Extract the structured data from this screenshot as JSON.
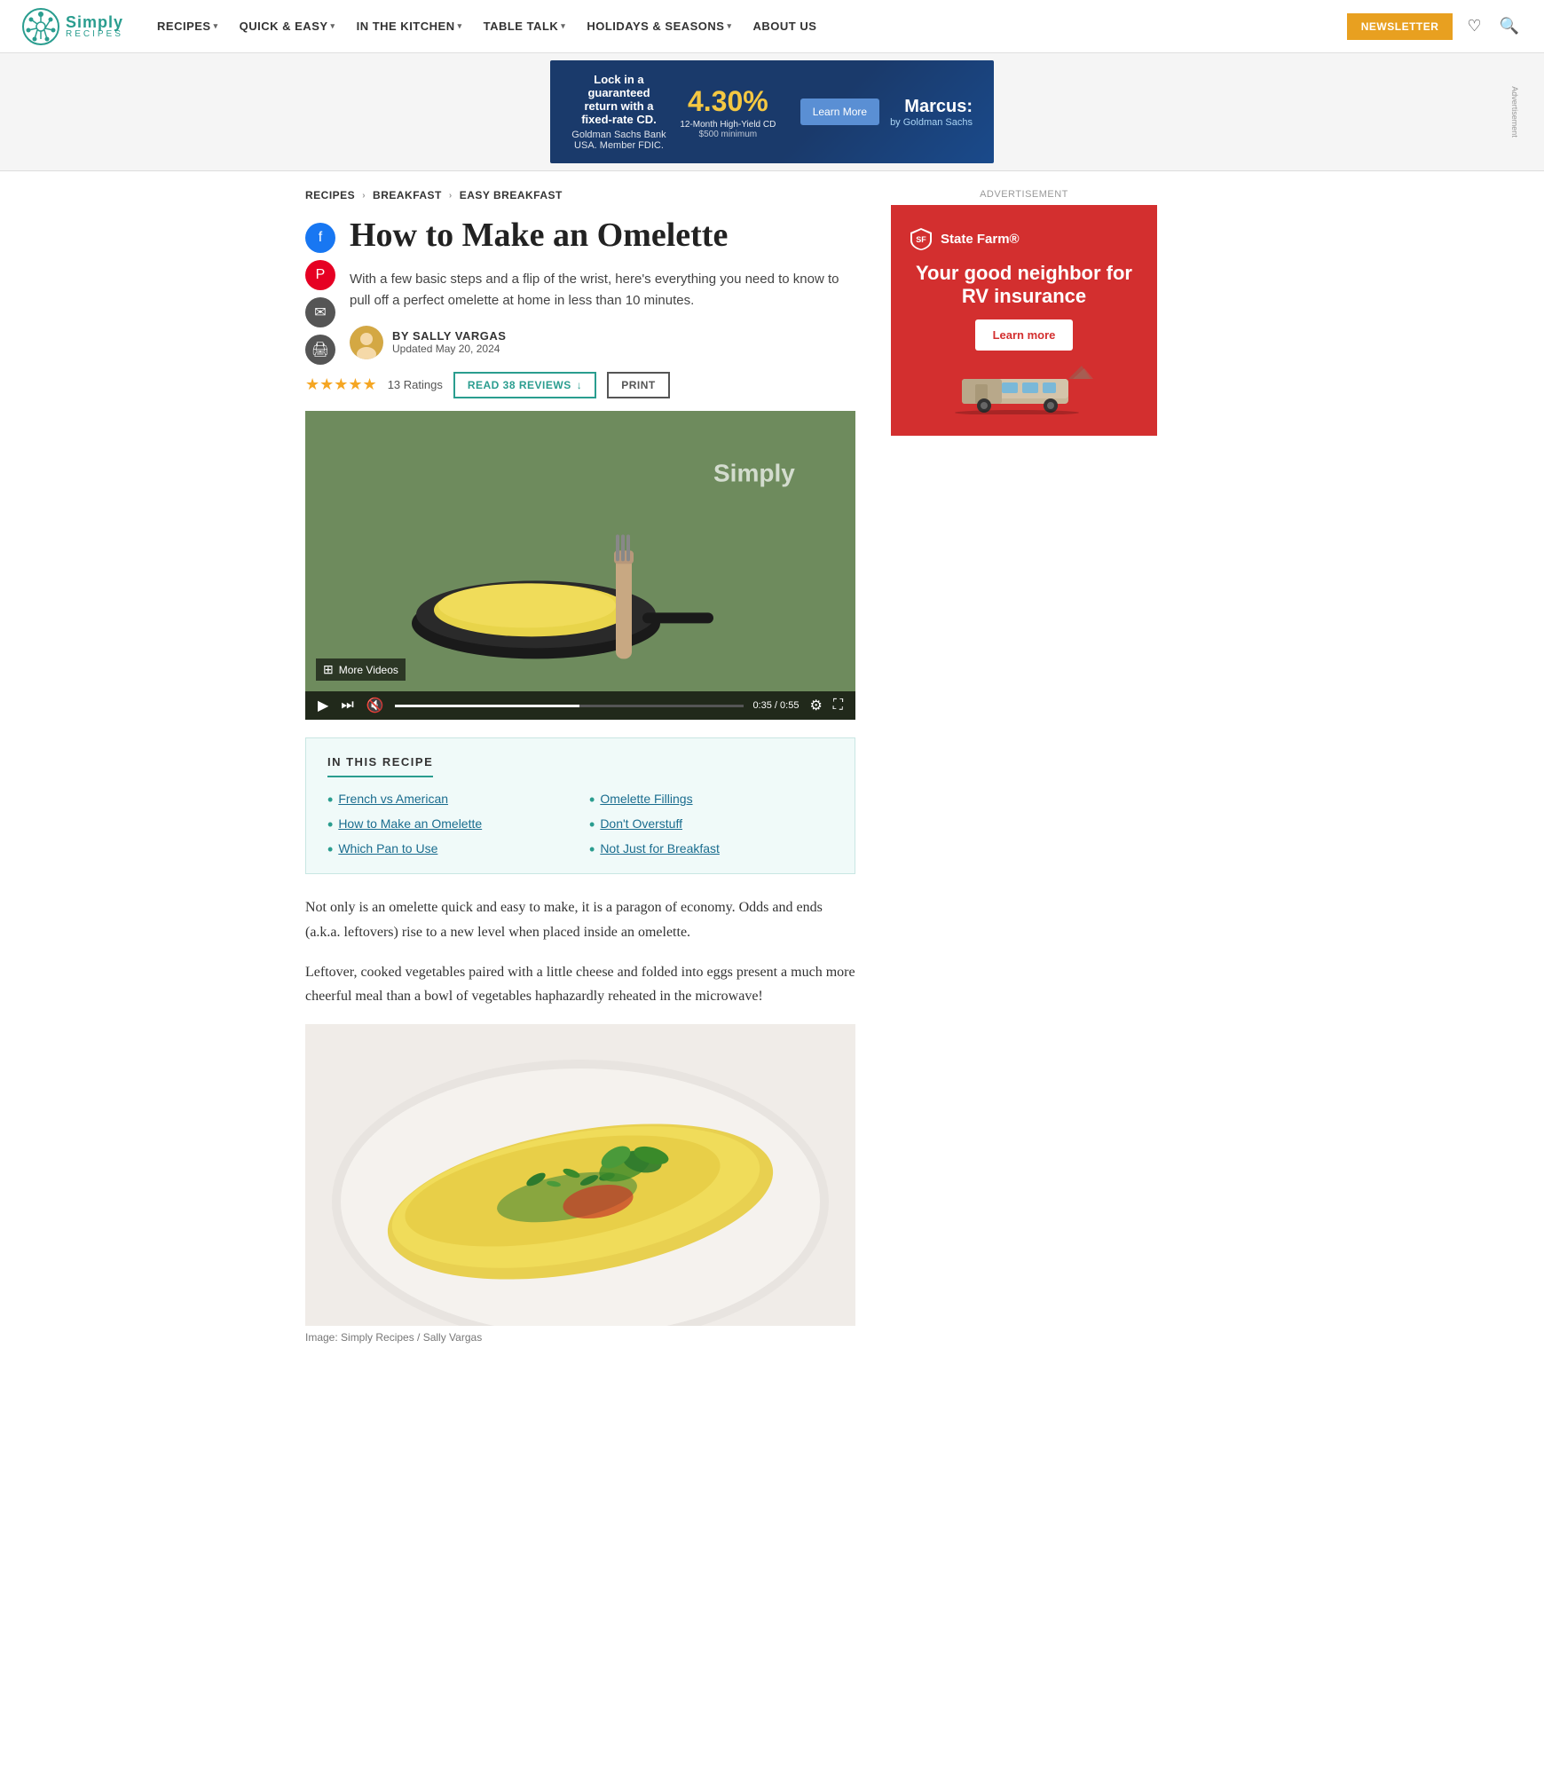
{
  "site": {
    "name": "Simply",
    "tagline": "RECIPES",
    "logo_alt": "Simply Recipes logo"
  },
  "nav": {
    "items": [
      {
        "label": "RECIPES",
        "has_dropdown": true
      },
      {
        "label": "QUICK & EASY",
        "has_dropdown": true
      },
      {
        "label": "IN THE KITCHEN",
        "has_dropdown": true
      },
      {
        "label": "TABLE TALK",
        "has_dropdown": true
      },
      {
        "label": "HOLIDAYS & SEASONS",
        "has_dropdown": true
      },
      {
        "label": "ABOUT US",
        "has_dropdown": false
      }
    ],
    "newsletter_label": "NEWSLETTER",
    "heart_icon": "♡",
    "search_icon": "🔍"
  },
  "ad_banner": {
    "headline": "Lock in a guaranteed return with a fixed-rate CD.",
    "sub": "Goldman Sachs Bank USA. Member FDIC.",
    "rate": "4.30%",
    "rate_label": "12-Month High-Yield CD",
    "cta": "Learn More",
    "brand": "Marcus:",
    "brand_sub": "by Goldman Sachs",
    "advertisement_label": "Advertisement",
    "min": "$500 minimum"
  },
  "breadcrumb": {
    "items": [
      "RECIPES",
      "BREAKFAST",
      "EASY BREAKFAST"
    ],
    "sep": "›"
  },
  "article": {
    "title": "How to Make an Omelette",
    "subtitle": "With a few basic steps and a flip of the wrist, here's everything you need to know to pull off a perfect omelette at home in less than 10 minutes.",
    "author_prefix": "BY",
    "author": "SALLY VARGAS",
    "updated_label": "Updated May 20, 2024",
    "stars": "★★★★★",
    "ratings_count": "13 Ratings",
    "read_reviews_label": "READ 38 REVIEWS",
    "read_reviews_icon": "↓",
    "print_label": "PRINT"
  },
  "video": {
    "more_videos_label": "More Videos",
    "overlay_brand": "Simply",
    "time_current": "0:35",
    "time_total": "0:55"
  },
  "in_recipe": {
    "title": "IN THIS RECIPE",
    "items": [
      {
        "label": "French vs American"
      },
      {
        "label": "Omelette Fillings"
      },
      {
        "label": "How to Make an Omelette"
      },
      {
        "label": "Don't Overstuff"
      },
      {
        "label": "Which Pan to Use"
      },
      {
        "label": "Not Just for Breakfast"
      }
    ]
  },
  "body": {
    "paragraph1": "Not only is an omelette quick and easy to make, it is a paragon of economy. Odds and ends (a.k.a. leftovers) rise to a new level when placed inside an omelette.",
    "paragraph2": "Leftover, cooked vegetables paired with a little cheese and folded into eggs present a much more cheerful meal than a bowl of vegetables haphazardly reheated in the microwave!"
  },
  "image_caption": "Image: Simply Recipes / Sally Vargas",
  "sidebar": {
    "ad_label": "Advertisement",
    "ad_logo": "🛡 State Farm®",
    "ad_headline": "Your good neighbor for RV insurance",
    "ad_cta": "Learn more"
  }
}
